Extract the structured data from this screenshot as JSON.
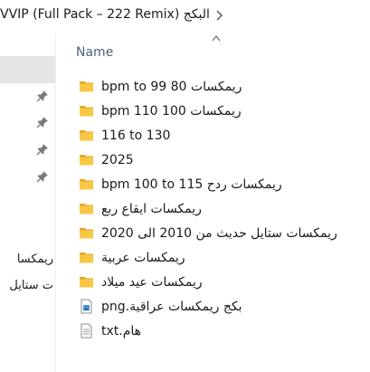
{
  "breadcrumb": {
    "path": "البكج VVIP (Full Pack – 222 Remix)"
  },
  "nav": {
    "labels": [
      "ريمكسا",
      "ت ستايل"
    ]
  },
  "list": {
    "column_name": "Name",
    "items": [
      {
        "name": "ريمكسات 80 bpm to 99",
        "icon": "folder-icon"
      },
      {
        "name": "ريمكسات 100 bpm 110",
        "icon": "folder-icon"
      },
      {
        "name": "116 to 130",
        "icon": "folder-icon"
      },
      {
        "name": "2025",
        "icon": "folder-icon"
      },
      {
        "name": "ريمكسات ردح bpm 100 to 115",
        "icon": "folder-icon"
      },
      {
        "name": "ريمكسات ايقاع ربع",
        "icon": "folder-icon"
      },
      {
        "name": "ريمكسات ستايل حديث من 2010 الى 2020",
        "icon": "folder-icon"
      },
      {
        "name": "ريمكسات عربية",
        "icon": "folder-icon"
      },
      {
        "name": "ريمكسات عيد ميلاد",
        "icon": "folder-icon"
      },
      {
        "name": "بكج ريمكسات عراقية.png",
        "icon": "image-file-icon"
      },
      {
        "name": "هام.txt",
        "icon": "text-file-icon"
      }
    ]
  },
  "colors": {
    "folder": "#f8c845",
    "folder_dark": "#e3a822",
    "header_text": "#4c607a",
    "selected_bg": "#e5e5e5"
  }
}
